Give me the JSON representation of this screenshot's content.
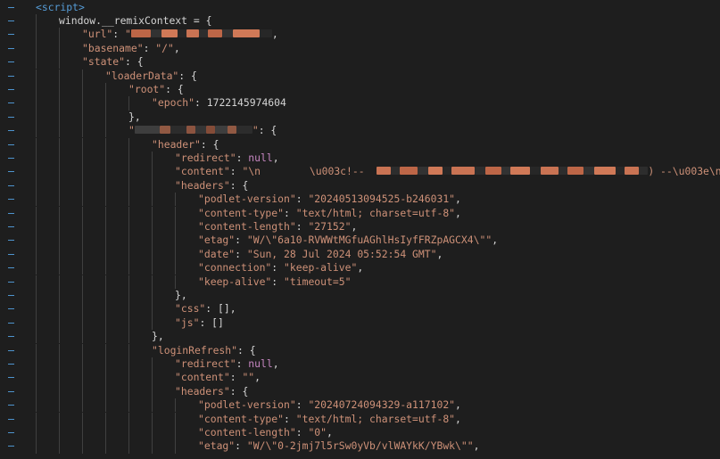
{
  "editor": {
    "lines": [
      {
        "indent": 1,
        "tokens": [
          {
            "t": "<script>",
            "c": "tag"
          }
        ]
      },
      {
        "indent": 2,
        "tokens": [
          {
            "t": "window.__remixContext = {",
            "c": "ident"
          }
        ]
      },
      {
        "indent": 3,
        "tokens": [
          {
            "t": "\"url\"",
            "c": "key"
          },
          {
            "t": ": ",
            "c": "punc"
          },
          {
            "t": "\"",
            "c": "str"
          },
          {
            "blur": [
              22,
              12,
              18,
              10,
              14,
              10,
              16,
              12,
              30,
              14
            ]
          },
          {
            "t": ",",
            "c": "punc"
          }
        ]
      },
      {
        "indent": 3,
        "tokens": [
          {
            "t": "\"basename\"",
            "c": "key"
          },
          {
            "t": ": ",
            "c": "punc"
          },
          {
            "t": "\"/\"",
            "c": "str"
          },
          {
            "t": ",",
            "c": "punc"
          }
        ]
      },
      {
        "indent": 3,
        "tokens": [
          {
            "t": "\"state\"",
            "c": "key"
          },
          {
            "t": ": {",
            "c": "punc"
          }
        ]
      },
      {
        "indent": 4,
        "tokens": [
          {
            "t": "\"loaderData\"",
            "c": "key"
          },
          {
            "t": ": {",
            "c": "punc"
          }
        ]
      },
      {
        "indent": 5,
        "tokens": [
          {
            "t": "\"root\"",
            "c": "key"
          },
          {
            "t": ": {",
            "c": "punc"
          }
        ]
      },
      {
        "indent": 6,
        "tokens": [
          {
            "t": "\"epoch\"",
            "c": "key"
          },
          {
            "t": ": ",
            "c": "punc"
          },
          {
            "t": "1722145974604",
            "c": "num"
          }
        ]
      },
      {
        "indent": 5,
        "tokens": [
          {
            "t": "},",
            "c": "punc"
          }
        ]
      },
      {
        "indent": 5,
        "tokens": [
          {
            "t": "\"",
            "c": "key"
          },
          {
            "blur": [
              28,
              12,
              18,
              10,
              12,
              10,
              14,
              10,
              18
            ]
          },
          {
            "t": "\"",
            "c": "key"
          },
          {
            "t": ": {",
            "c": "punc"
          }
        ]
      },
      {
        "indent": 6,
        "tokens": [
          {
            "t": "\"header\"",
            "c": "key"
          },
          {
            "t": ": {",
            "c": "punc"
          }
        ]
      },
      {
        "indent": 7,
        "tokens": [
          {
            "t": "\"redirect\"",
            "c": "key"
          },
          {
            "t": ": ",
            "c": "punc"
          },
          {
            "t": "null",
            "c": "kw"
          },
          {
            "t": ",",
            "c": "punc"
          }
        ]
      },
      {
        "indent": 7,
        "tokens": [
          {
            "t": "\"content\"",
            "c": "key"
          },
          {
            "t": ": ",
            "c": "punc"
          },
          {
            "t": "\"\\n        \\u003c!--  ",
            "c": "str"
          },
          {
            "blur": [
              16,
              10,
              20,
              12,
              16,
              10,
              26,
              12,
              18,
              10,
              22,
              12,
              20,
              10,
              18,
              12,
              24,
              10,
              16,
              10
            ]
          },
          {
            "t": ") --\\u003e\\n",
            "c": "str"
          }
        ]
      },
      {
        "indent": 7,
        "tokens": [
          {
            "t": "\"headers\"",
            "c": "key"
          },
          {
            "t": ": {",
            "c": "punc"
          }
        ]
      },
      {
        "indent": 8,
        "tokens": [
          {
            "t": "\"podlet-version\"",
            "c": "key"
          },
          {
            "t": ": ",
            "c": "punc"
          },
          {
            "t": "\"20240513094525-b246031\"",
            "c": "str"
          },
          {
            "t": ",",
            "c": "punc"
          }
        ]
      },
      {
        "indent": 8,
        "tokens": [
          {
            "t": "\"content-type\"",
            "c": "key"
          },
          {
            "t": ": ",
            "c": "punc"
          },
          {
            "t": "\"text/html; charset=utf-8\"",
            "c": "str"
          },
          {
            "t": ",",
            "c": "punc"
          }
        ]
      },
      {
        "indent": 8,
        "tokens": [
          {
            "t": "\"content-length\"",
            "c": "key"
          },
          {
            "t": ": ",
            "c": "punc"
          },
          {
            "t": "\"27152\"",
            "c": "str"
          },
          {
            "t": ",",
            "c": "punc"
          }
        ]
      },
      {
        "indent": 8,
        "tokens": [
          {
            "t": "\"etag\"",
            "c": "key"
          },
          {
            "t": ": ",
            "c": "punc"
          },
          {
            "t": "\"W/\\\"6a10-RVWWtMGfuAGhlHsIyfFRZpAGCX4\\\"\"",
            "c": "str"
          },
          {
            "t": ",",
            "c": "punc"
          }
        ]
      },
      {
        "indent": 8,
        "tokens": [
          {
            "t": "\"date\"",
            "c": "key"
          },
          {
            "t": ": ",
            "c": "punc"
          },
          {
            "t": "\"Sun, 28 Jul 2024 05:52:54 GMT\"",
            "c": "str"
          },
          {
            "t": ",",
            "c": "punc"
          }
        ]
      },
      {
        "indent": 8,
        "tokens": [
          {
            "t": "\"connection\"",
            "c": "key"
          },
          {
            "t": ": ",
            "c": "punc"
          },
          {
            "t": "\"keep-alive\"",
            "c": "str"
          },
          {
            "t": ",",
            "c": "punc"
          }
        ]
      },
      {
        "indent": 8,
        "tokens": [
          {
            "t": "\"keep-alive\"",
            "c": "key"
          },
          {
            "t": ": ",
            "c": "punc"
          },
          {
            "t": "\"timeout=5\"",
            "c": "str"
          }
        ]
      },
      {
        "indent": 7,
        "tokens": [
          {
            "t": "},",
            "c": "punc"
          }
        ]
      },
      {
        "indent": 7,
        "tokens": [
          {
            "t": "\"css\"",
            "c": "key"
          },
          {
            "t": ": [],",
            "c": "punc"
          }
        ]
      },
      {
        "indent": 7,
        "tokens": [
          {
            "t": "\"js\"",
            "c": "key"
          },
          {
            "t": ": []",
            "c": "punc"
          }
        ]
      },
      {
        "indent": 6,
        "tokens": [
          {
            "t": "},",
            "c": "punc"
          }
        ]
      },
      {
        "indent": 6,
        "tokens": [
          {
            "t": "\"loginRefresh\"",
            "c": "key"
          },
          {
            "t": ": {",
            "c": "punc"
          }
        ]
      },
      {
        "indent": 7,
        "tokens": [
          {
            "t": "\"redirect\"",
            "c": "key"
          },
          {
            "t": ": ",
            "c": "punc"
          },
          {
            "t": "null",
            "c": "kw"
          },
          {
            "t": ",",
            "c": "punc"
          }
        ]
      },
      {
        "indent": 7,
        "tokens": [
          {
            "t": "\"content\"",
            "c": "key"
          },
          {
            "t": ": ",
            "c": "punc"
          },
          {
            "t": "\"\"",
            "c": "str"
          },
          {
            "t": ",",
            "c": "punc"
          }
        ]
      },
      {
        "indent": 7,
        "tokens": [
          {
            "t": "\"headers\"",
            "c": "key"
          },
          {
            "t": ": {",
            "c": "punc"
          }
        ]
      },
      {
        "indent": 8,
        "tokens": [
          {
            "t": "\"podlet-version\"",
            "c": "key"
          },
          {
            "t": ": ",
            "c": "punc"
          },
          {
            "t": "\"20240724094329-a117102\"",
            "c": "str"
          },
          {
            "t": ",",
            "c": "punc"
          }
        ]
      },
      {
        "indent": 8,
        "tokens": [
          {
            "t": "\"content-type\"",
            "c": "key"
          },
          {
            "t": ": ",
            "c": "punc"
          },
          {
            "t": "\"text/html; charset=utf-8\"",
            "c": "str"
          },
          {
            "t": ",",
            "c": "punc"
          }
        ]
      },
      {
        "indent": 8,
        "tokens": [
          {
            "t": "\"content-length\"",
            "c": "key"
          },
          {
            "t": ": ",
            "c": "punc"
          },
          {
            "t": "\"0\"",
            "c": "str"
          },
          {
            "t": ",",
            "c": "punc"
          }
        ]
      },
      {
        "indent": 8,
        "tokens": [
          {
            "t": "\"etag\"",
            "c": "key"
          },
          {
            "t": ": ",
            "c": "punc"
          },
          {
            "t": "\"W/\\\"0-2jmj7l5rSw0yVb/vlWAYkK/YBwk\\\"\"",
            "c": "str"
          },
          {
            "t": ",",
            "c": "punc"
          }
        ]
      }
    ]
  }
}
